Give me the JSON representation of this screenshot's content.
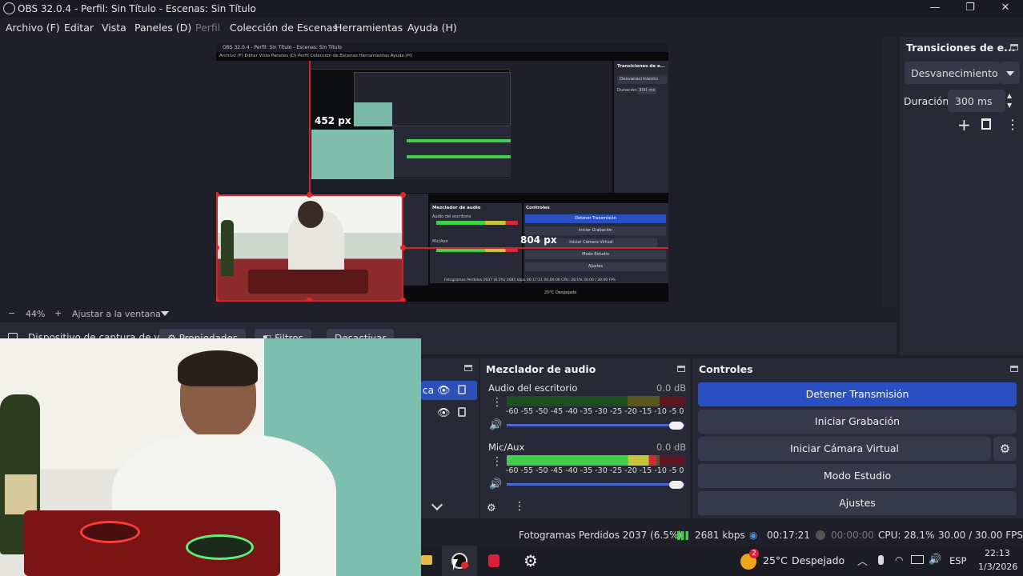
{
  "window": {
    "title": "OBS 32.0.4 - Perfil: Sin Título - Escenas: Sin Título",
    "minimize_glyph": "—",
    "restore_glyph": "❐",
    "close_glyph": "✕"
  },
  "menu": {
    "items": [
      "Archivo (F)",
      "Editar",
      "Vista",
      "Paneles (D)",
      "Perfil",
      "Colección de Escenas",
      "Herramientas",
      "Ayuda (H)"
    ]
  },
  "preview": {
    "zoom_minus": "−",
    "zoom": "44%",
    "zoom_plus": "+",
    "fit_label": "Ajustar a la ventana",
    "nested_title": "OBS 32.0.4 - Perfil: Sin Título - Escenas: Sin Título",
    "measure_top": "452 px",
    "measure_right": "804 px",
    "nested_menu": "Archivo (F)   Editar   Vista   Paneles (D)   Perfil   Colección de Escenas   Herramientas   Ayuda (H)",
    "nested_transitions": "Transiciones de e...",
    "nested_fade": "Desvanecimiento",
    "nested_duration": "Duración",
    "nested_ms": "300 ms",
    "nested_mixer": "Mezclador de audio",
    "nested_controls": "Controles",
    "nested_desktop": "Audio del escritorio",
    "nested_mic": "Mic/Aux",
    "nested_btn1": "Detener Transmisión",
    "nested_btn2": "Iniciar Grabación",
    "nested_btn3": "Iniciar Cámara Virtual",
    "nested_btn4": "Modo Estudio",
    "nested_btn5": "Ajustes",
    "nested_status": "Fotogramas Perdidos 2037 (6.5%)    2681 kbps    00:17:21    00:00:00    CPU: 28.1%    30.00 / 30.00 FPS",
    "nested_weather": "25°C  Despejado"
  },
  "source_toolbar": {
    "source_name": "Dispositivo de captura de v",
    "properties": "Propiedades",
    "filters": "Filtros",
    "deactivate": "Desactivar"
  },
  "transitions": {
    "title": "Transiciones de e...",
    "selected": "Desvanecimiento",
    "duration_label": "Duración",
    "duration_value": "300 ms",
    "add_glyph": "+",
    "more_glyph": "⋮"
  },
  "sources": {
    "item_fragment": "ca"
  },
  "mixer": {
    "title": "Mezclador de audio",
    "more_glyph": "⋮",
    "ticks": "-60  -55  -50  -45  -40  -35  -30  -25  -20  -15  -10   -5   0",
    "channels": [
      {
        "name": "Audio del escritorio",
        "db": "0.0 dB",
        "level": 0.0
      },
      {
        "name": "Mic/Aux",
        "db": "0.0 dB",
        "level": 0.84
      }
    ]
  },
  "controls": {
    "title": "Controles",
    "buttons": [
      "Detener Transmisión",
      "Iniciar Grabación",
      "Iniciar Cámara Virtual",
      "Modo Estudio",
      "Ajustes"
    ]
  },
  "status": {
    "dropped": "Fotogramas Perdidos 2037 (6.5%)",
    "bitrate": "2681 kbps",
    "stream_time": "00:17:21",
    "rec_time": "00:00:00",
    "cpu": "CPU: 28.1%",
    "fps": "30.00 / 30.00 FPS"
  },
  "taskbar": {
    "weather_badge": "2",
    "weather": "25°C",
    "weather_desc": "Despejado",
    "tray_chevron": "︿",
    "lang": "ESP",
    "time": "22:13",
    "date": "1/3/2026"
  },
  "colors": {
    "accent": "#2a4fc0",
    "meter_green": "#3fcf4b",
    "meter_yellow": "#c9c53a",
    "meter_red": "#d12b3a",
    "selection_red": "#d3242a"
  }
}
